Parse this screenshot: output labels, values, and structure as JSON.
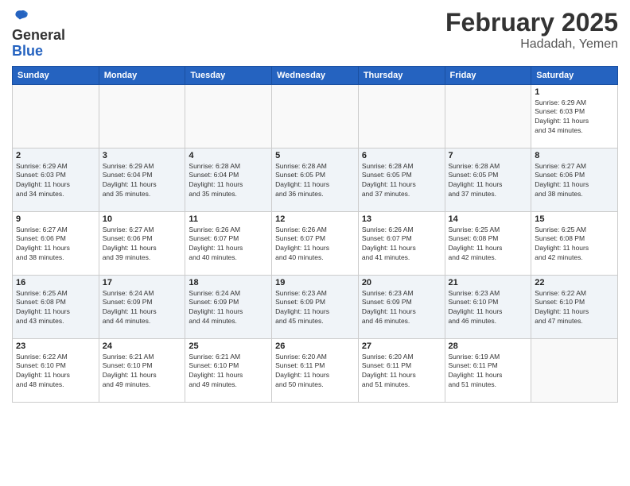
{
  "header": {
    "logo_general": "General",
    "logo_blue": "Blue",
    "title": "February 2025",
    "subtitle": "Hadadah, Yemen"
  },
  "weekdays": [
    "Sunday",
    "Monday",
    "Tuesday",
    "Wednesday",
    "Thursday",
    "Friday",
    "Saturday"
  ],
  "weeks": [
    [
      {
        "day": "",
        "info": ""
      },
      {
        "day": "",
        "info": ""
      },
      {
        "day": "",
        "info": ""
      },
      {
        "day": "",
        "info": ""
      },
      {
        "day": "",
        "info": ""
      },
      {
        "day": "",
        "info": ""
      },
      {
        "day": "1",
        "info": "Sunrise: 6:29 AM\nSunset: 6:03 PM\nDaylight: 11 hours\nand 34 minutes."
      }
    ],
    [
      {
        "day": "2",
        "info": "Sunrise: 6:29 AM\nSunset: 6:03 PM\nDaylight: 11 hours\nand 34 minutes."
      },
      {
        "day": "3",
        "info": "Sunrise: 6:29 AM\nSunset: 6:04 PM\nDaylight: 11 hours\nand 35 minutes."
      },
      {
        "day": "4",
        "info": "Sunrise: 6:28 AM\nSunset: 6:04 PM\nDaylight: 11 hours\nand 35 minutes."
      },
      {
        "day": "5",
        "info": "Sunrise: 6:28 AM\nSunset: 6:05 PM\nDaylight: 11 hours\nand 36 minutes."
      },
      {
        "day": "6",
        "info": "Sunrise: 6:28 AM\nSunset: 6:05 PM\nDaylight: 11 hours\nand 37 minutes."
      },
      {
        "day": "7",
        "info": "Sunrise: 6:28 AM\nSunset: 6:05 PM\nDaylight: 11 hours\nand 37 minutes."
      },
      {
        "day": "8",
        "info": "Sunrise: 6:27 AM\nSunset: 6:06 PM\nDaylight: 11 hours\nand 38 minutes."
      }
    ],
    [
      {
        "day": "9",
        "info": "Sunrise: 6:27 AM\nSunset: 6:06 PM\nDaylight: 11 hours\nand 38 minutes."
      },
      {
        "day": "10",
        "info": "Sunrise: 6:27 AM\nSunset: 6:06 PM\nDaylight: 11 hours\nand 39 minutes."
      },
      {
        "day": "11",
        "info": "Sunrise: 6:26 AM\nSunset: 6:07 PM\nDaylight: 11 hours\nand 40 minutes."
      },
      {
        "day": "12",
        "info": "Sunrise: 6:26 AM\nSunset: 6:07 PM\nDaylight: 11 hours\nand 40 minutes."
      },
      {
        "day": "13",
        "info": "Sunrise: 6:26 AM\nSunset: 6:07 PM\nDaylight: 11 hours\nand 41 minutes."
      },
      {
        "day": "14",
        "info": "Sunrise: 6:25 AM\nSunset: 6:08 PM\nDaylight: 11 hours\nand 42 minutes."
      },
      {
        "day": "15",
        "info": "Sunrise: 6:25 AM\nSunset: 6:08 PM\nDaylight: 11 hours\nand 42 minutes."
      }
    ],
    [
      {
        "day": "16",
        "info": "Sunrise: 6:25 AM\nSunset: 6:08 PM\nDaylight: 11 hours\nand 43 minutes."
      },
      {
        "day": "17",
        "info": "Sunrise: 6:24 AM\nSunset: 6:09 PM\nDaylight: 11 hours\nand 44 minutes."
      },
      {
        "day": "18",
        "info": "Sunrise: 6:24 AM\nSunset: 6:09 PM\nDaylight: 11 hours\nand 44 minutes."
      },
      {
        "day": "19",
        "info": "Sunrise: 6:23 AM\nSunset: 6:09 PM\nDaylight: 11 hours\nand 45 minutes."
      },
      {
        "day": "20",
        "info": "Sunrise: 6:23 AM\nSunset: 6:09 PM\nDaylight: 11 hours\nand 46 minutes."
      },
      {
        "day": "21",
        "info": "Sunrise: 6:23 AM\nSunset: 6:10 PM\nDaylight: 11 hours\nand 46 minutes."
      },
      {
        "day": "22",
        "info": "Sunrise: 6:22 AM\nSunset: 6:10 PM\nDaylight: 11 hours\nand 47 minutes."
      }
    ],
    [
      {
        "day": "23",
        "info": "Sunrise: 6:22 AM\nSunset: 6:10 PM\nDaylight: 11 hours\nand 48 minutes."
      },
      {
        "day": "24",
        "info": "Sunrise: 6:21 AM\nSunset: 6:10 PM\nDaylight: 11 hours\nand 49 minutes."
      },
      {
        "day": "25",
        "info": "Sunrise: 6:21 AM\nSunset: 6:10 PM\nDaylight: 11 hours\nand 49 minutes."
      },
      {
        "day": "26",
        "info": "Sunrise: 6:20 AM\nSunset: 6:11 PM\nDaylight: 11 hours\nand 50 minutes."
      },
      {
        "day": "27",
        "info": "Sunrise: 6:20 AM\nSunset: 6:11 PM\nDaylight: 11 hours\nand 51 minutes."
      },
      {
        "day": "28",
        "info": "Sunrise: 6:19 AM\nSunset: 6:11 PM\nDaylight: 11 hours\nand 51 minutes."
      },
      {
        "day": "",
        "info": ""
      }
    ]
  ]
}
